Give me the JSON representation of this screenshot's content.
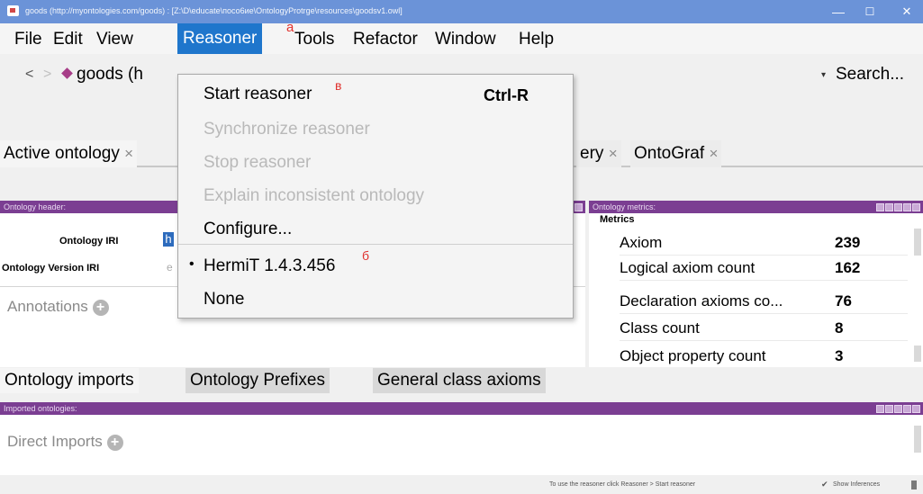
{
  "window": {
    "title": "goods (http://myontologies.com/goods) : [Z:\\D\\educate\\посо6ие\\OntologyProtrge\\resources\\goodsv1.owl]",
    "minimize": "—",
    "maximize": "☐",
    "close": "✕"
  },
  "menubar": {
    "items": [
      "File",
      "Edit",
      "View",
      "Reasoner",
      "Tools",
      "Refactor",
      "Window",
      "Help"
    ],
    "active": "Reasoner",
    "annotation": "a"
  },
  "address": {
    "back": "<",
    "forward": ">",
    "ontology_text": "goods (h",
    "search_arrow": "▾",
    "search": "Search..."
  },
  "tabs": {
    "first": "Active ontology",
    "first_close": "×",
    "partial": "ery",
    "partial_close": "×",
    "ontograf": "OntoGraf",
    "ontograf_close": "×"
  },
  "ontology_header": {
    "panel_title": "Ontology header:",
    "iri_label": "Ontology IRI",
    "iri_value": "h",
    "version_label": "Ontology Version IRI",
    "version_value": "e",
    "annotations": "Annotations",
    "add": "+"
  },
  "metrics": {
    "panel_title": "Ontology metrics:",
    "title": "Metrics",
    "rows": [
      {
        "label": "Axiom",
        "value": "239"
      },
      {
        "label": "Logical axiom count",
        "value": "162"
      },
      {
        "label": "Declaration axioms co...",
        "value": "76"
      },
      {
        "label": "Class count",
        "value": "8"
      },
      {
        "label": "Object property count",
        "value": "3"
      }
    ]
  },
  "lower_tabs": [
    "Ontology imports",
    "Ontology Prefixes",
    "General class axioms"
  ],
  "imports": {
    "panel_title": "Imported ontologies:",
    "direct": "Direct Imports",
    "add": "+"
  },
  "status": {
    "hint": "To use the reasoner click Reasoner > Start reasoner",
    "check": "✔",
    "show_inferences": "Show Inferences"
  },
  "reasoner_menu": {
    "start": "Start reasoner",
    "start_mark": "в",
    "shortcut": "Ctrl-R",
    "synchronize": "Synchronize reasoner",
    "stop": "Stop reasoner",
    "explain": "Explain inconsistent ontology",
    "configure": "Configure...",
    "bullet": "•",
    "hermit": "HermiT 1.4.3.456",
    "hermit_mark": "б",
    "none": "None"
  },
  "colors": {
    "menu_highlight": "#1f76cc",
    "panel_header": "#7b3e92",
    "titlebar": "#6b93d8",
    "annotation_red": "#e0312d"
  }
}
